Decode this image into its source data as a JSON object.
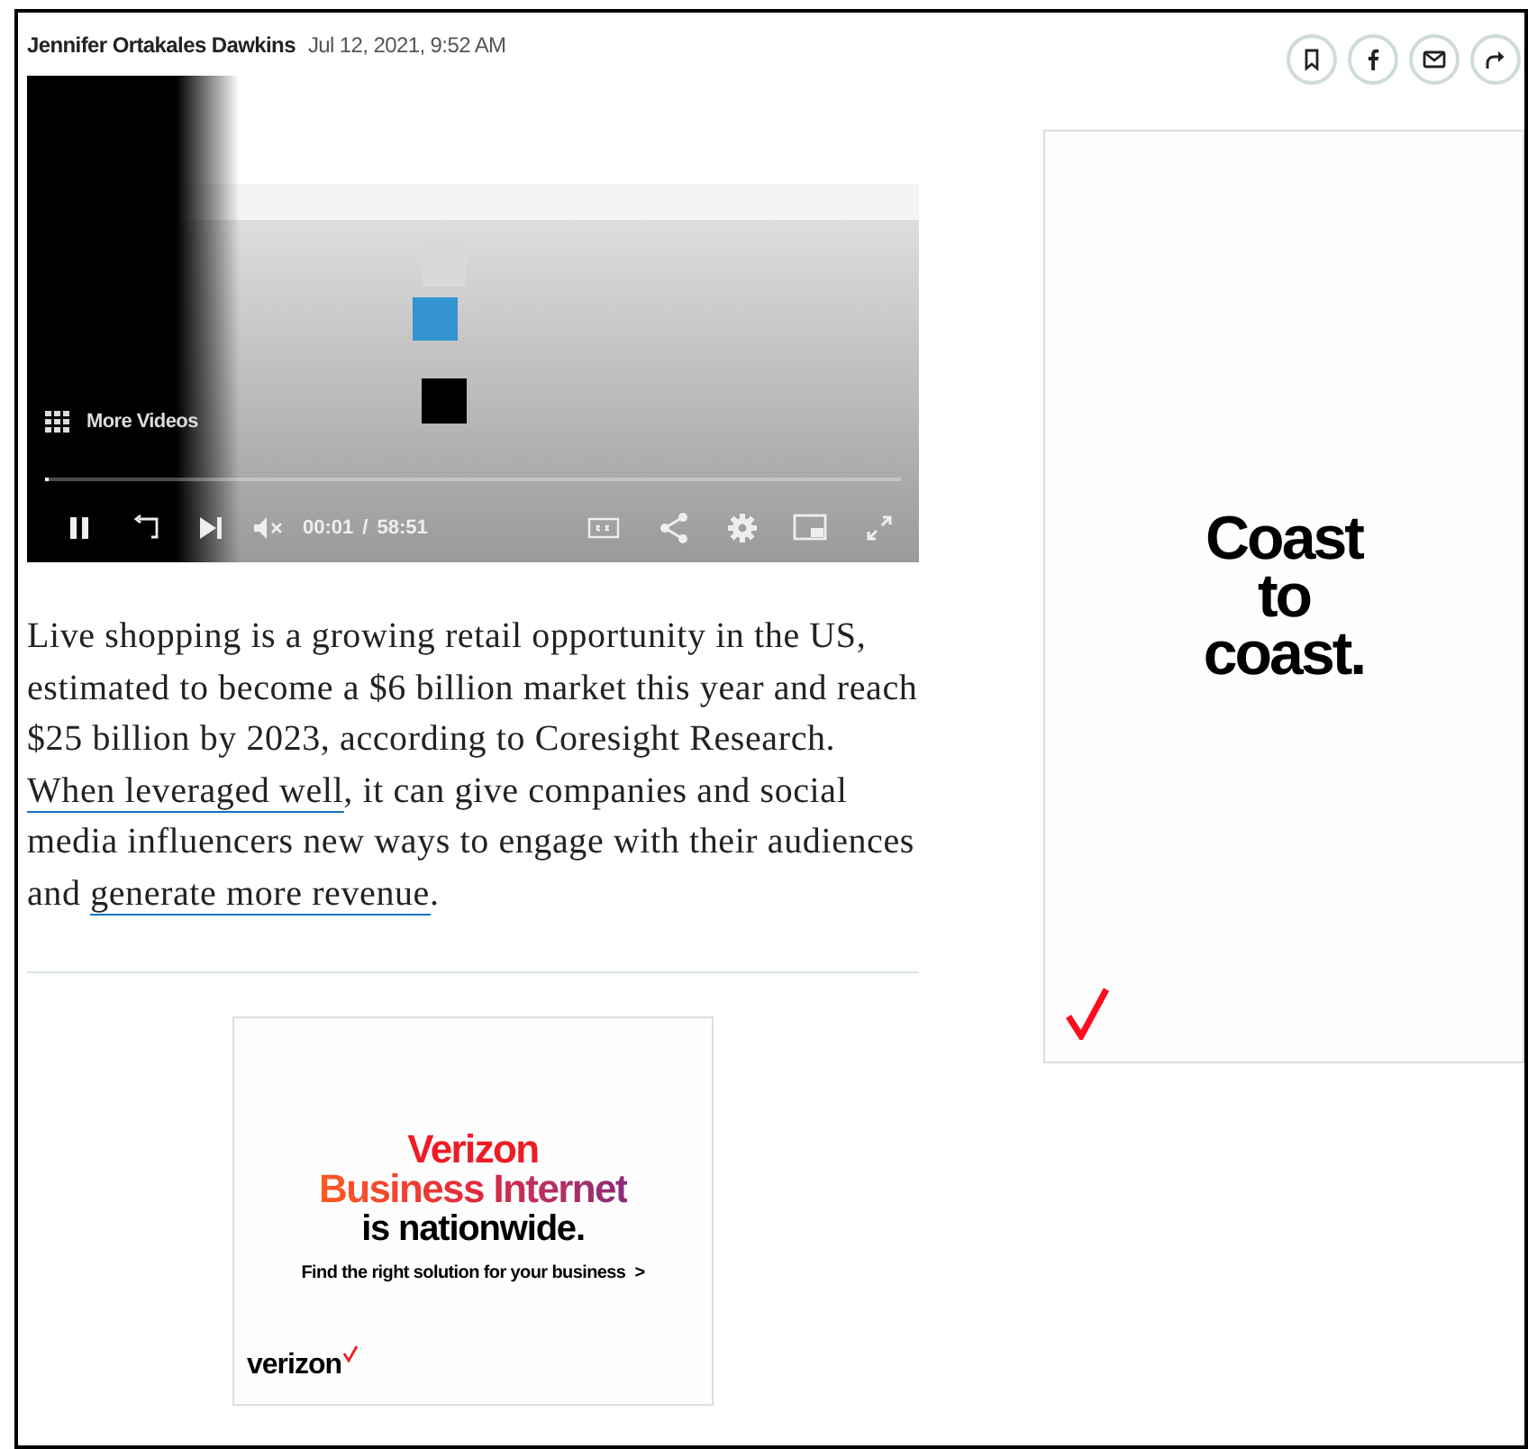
{
  "byline": {
    "author": "Jennifer Ortakales Dawkins",
    "date": "Jul 12, 2021, 9:52 AM"
  },
  "share_buttons": [
    {
      "kind": "bookmark"
    },
    {
      "kind": "facebook"
    },
    {
      "kind": "email"
    },
    {
      "kind": "share"
    }
  ],
  "video": {
    "more_videos": "More Videos",
    "playing": true,
    "muted": true,
    "progress": {
      "level": 0.004
    },
    "current_time": "00:01",
    "separator": "/",
    "duration": "58:51"
  },
  "article": {
    "segments": [
      {
        "text": "Live shopping is a growing retail opportunity in the US, estimated to become a $6 billion market this year and reach $25 billion by 2023, according to Coresight Research. ",
        "link": false
      },
      {
        "text": "When leveraged well",
        "link": true
      },
      {
        "text": ", it can give companies and social media influencers new ways to engage with their audiences and ",
        "link": false
      },
      {
        "text": "generate more revenue",
        "link": true
      },
      {
        "text": ".",
        "link": false
      }
    ]
  },
  "ad_inline": {
    "line_1": "Verizon",
    "line_2": "Business Internet",
    "line_3": "is nationwide.",
    "cta": "Find the right solution for your business",
    "cta_arrow": ">",
    "logo": "verizon"
  },
  "ad_side": {
    "headline": [
      "Coast",
      "to",
      "coast."
    ]
  }
}
